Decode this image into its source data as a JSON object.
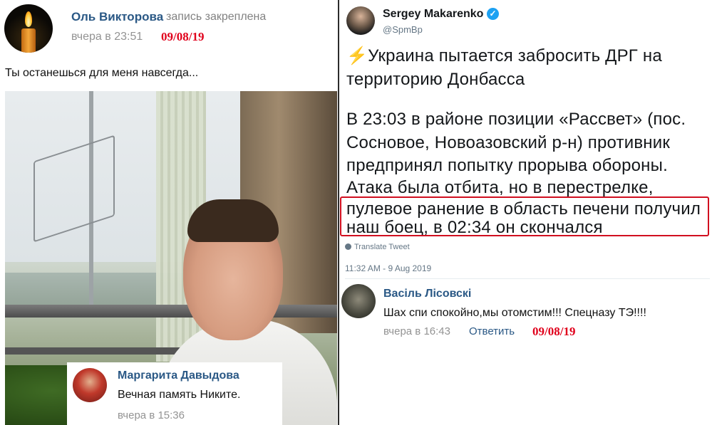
{
  "left_post": {
    "author": "Оль Викторова",
    "pinned_note": "запись закреплена",
    "time": "вчера в 23:51",
    "date_annotation": "09/08/19",
    "text": "Ты останешься для меня навсегда..."
  },
  "left_comment": {
    "author": "Маргарита Давыдова",
    "text": "Вечная память Никите.",
    "time": "вчера в 15:36"
  },
  "tweet": {
    "name": "Sergey Makarenko",
    "verified_mark": "✓",
    "handle": "@SpmBp",
    "bolt_icon": "⚡",
    "lines": [
      "Украина пытается забросить ДРГ на",
      "территорию Донбасса",
      "В 23:03 в районе позиции «Рассвет» (пос.",
      "Сосновое, Новоазовский р-н) противник",
      "предпринял попытку прорыва обороны.",
      "Атака была отбита, но в перестрелке,",
      "пулевое ранение в область печени получил",
      "наш боец, в 02:34 он скончался"
    ],
    "translate_label": "Translate Tweet",
    "timestamp": "11:32 AM - 9 Aug 2019"
  },
  "right_comment": {
    "author": "Васіль Лісовскі",
    "text": "Шах спи спокойно,мы отомстим!!! Спецназу ТЭ!!!!",
    "time": "вчера в 16:43",
    "reply_label": "Ответить",
    "date_annotation": "09/08/19"
  },
  "colors": {
    "vk_link": "#2a5885",
    "annotation_red": "#e0001b",
    "highlight_border": "#d10f1f",
    "twitter_verified": "#1da1f2"
  }
}
